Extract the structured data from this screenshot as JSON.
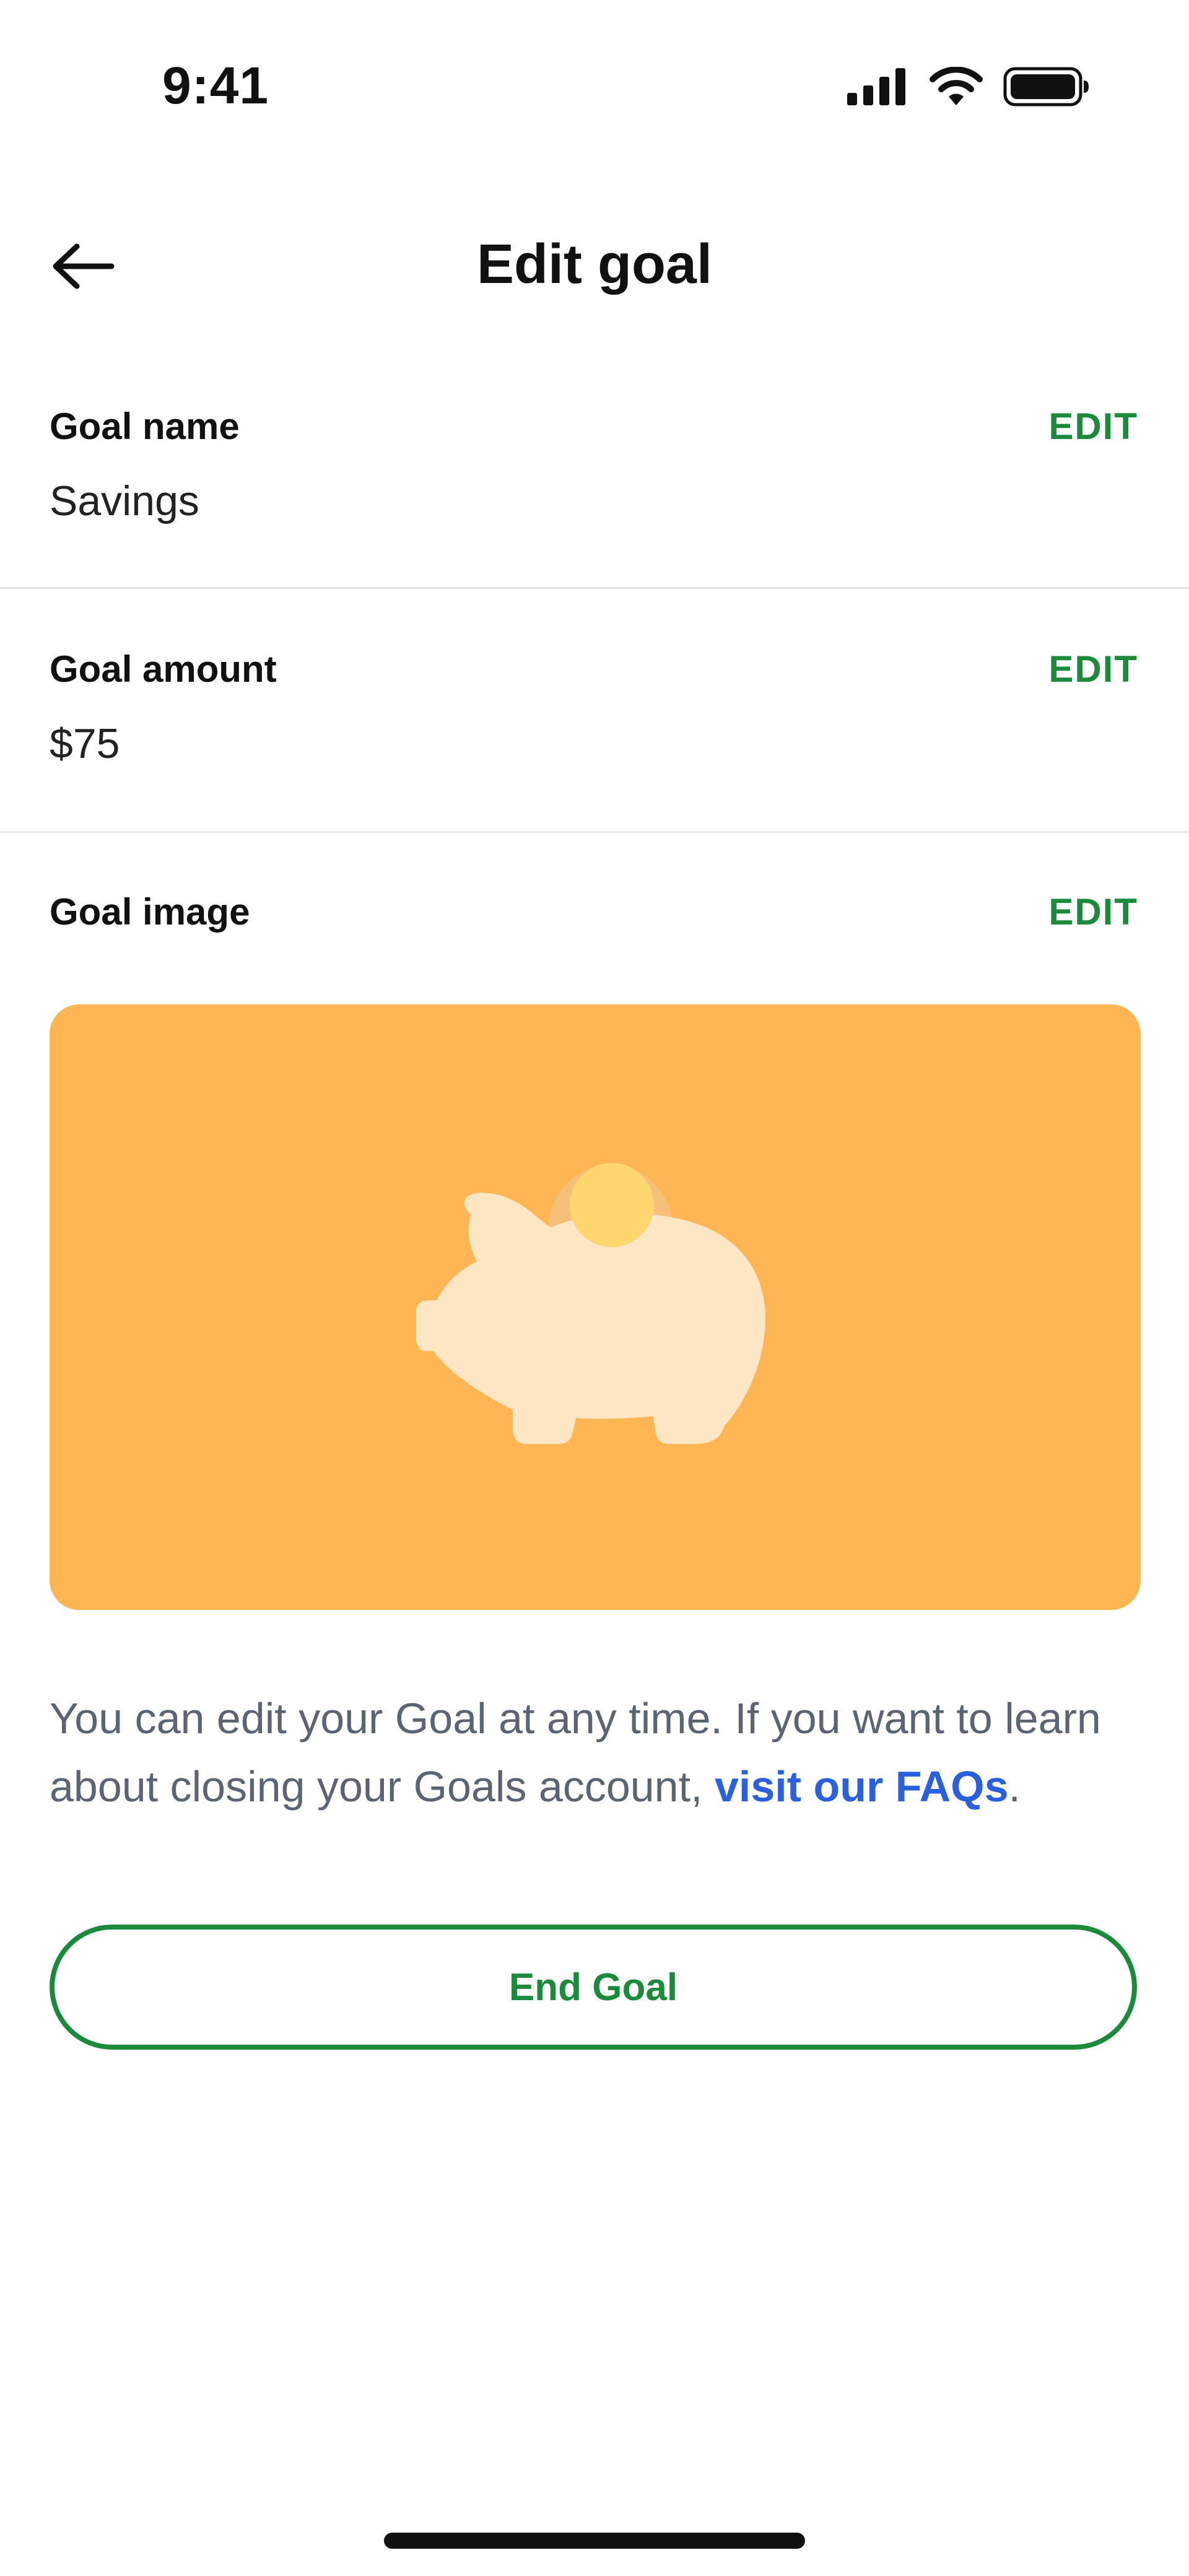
{
  "status_bar": {
    "time": "9:41",
    "icons": [
      "signal-icon",
      "wifi-icon",
      "battery-icon"
    ]
  },
  "header": {
    "back_icon": "arrow-left-icon",
    "title": "Edit goal"
  },
  "sections": {
    "goal_name": {
      "label": "Goal name",
      "value": "Savings",
      "edit_label": "EDIT"
    },
    "goal_amount": {
      "label": "Goal amount",
      "value": "$75",
      "edit_label": "EDIT"
    },
    "goal_image": {
      "label": "Goal image",
      "edit_label": "EDIT",
      "image_icon": "piggy-bank-icon"
    }
  },
  "info": {
    "text": "You can edit your Goal at any time. If you want to learn about closing your Goals account, ",
    "link_text": "visit our FAQs",
    "suffix": "."
  },
  "actions": {
    "end_goal_label": "End Goal"
  },
  "colors": {
    "accent_green": "#1b8a3b",
    "link_blue": "#2a60e0",
    "card_orange": "#fdb653",
    "piggy_body": "#fde6c4",
    "coin": "#fdd670"
  }
}
